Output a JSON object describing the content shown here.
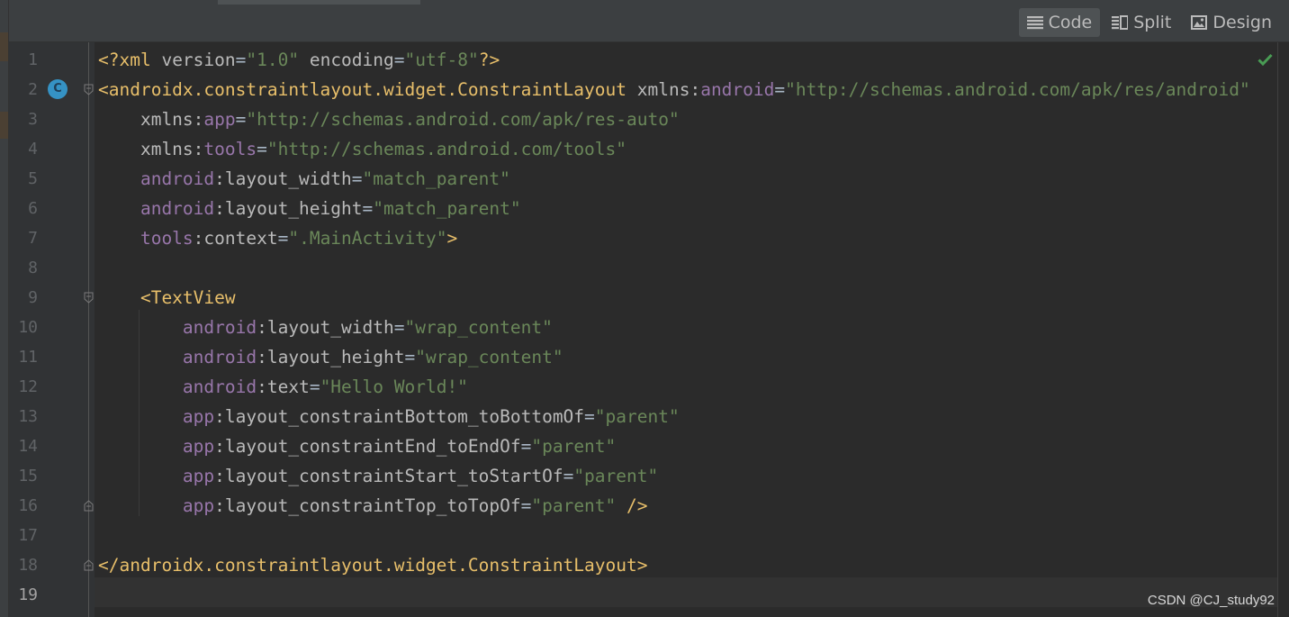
{
  "toolbar": {
    "code_label": "Code",
    "split_label": "Split",
    "design_label": "Design",
    "active_view": "Code"
  },
  "gutter": {
    "class_badge_letter": "C"
  },
  "lines": [
    {
      "num": "1",
      "segs": [
        [
          "tag",
          "<?xml "
        ],
        [
          "attr",
          "version"
        ],
        [
          "pun",
          "="
        ],
        [
          "str",
          "\"1.0\""
        ],
        [
          "attr",
          " encoding"
        ],
        [
          "pun",
          "="
        ],
        [
          "str",
          "\"utf-8\""
        ],
        [
          "tag",
          "?>"
        ]
      ]
    },
    {
      "num": "2",
      "segs": [
        [
          "tag",
          "<androidx.constraintlayout.widget.ConstraintLayout "
        ],
        [
          "attr",
          "xmlns:"
        ],
        [
          "ns",
          "android"
        ],
        [
          "pun",
          "="
        ],
        [
          "str",
          "\"http://schemas.android.com/apk/res/android\""
        ]
      ]
    },
    {
      "num": "3",
      "segs": [
        [
          "attr",
          "    xmlns:"
        ],
        [
          "ns",
          "app"
        ],
        [
          "pun",
          "="
        ],
        [
          "str",
          "\"http://schemas.android.com/apk/res-auto\""
        ]
      ]
    },
    {
      "num": "4",
      "segs": [
        [
          "attr",
          "    xmlns:"
        ],
        [
          "ns",
          "tools"
        ],
        [
          "pun",
          "="
        ],
        [
          "str",
          "\"http://schemas.android.com/tools\""
        ]
      ]
    },
    {
      "num": "5",
      "segs": [
        [
          "ns",
          "    android"
        ],
        [
          "attr",
          ":layout_width"
        ],
        [
          "pun",
          "="
        ],
        [
          "str",
          "\"match_parent\""
        ]
      ]
    },
    {
      "num": "6",
      "segs": [
        [
          "ns",
          "    android"
        ],
        [
          "attr",
          ":layout_height"
        ],
        [
          "pun",
          "="
        ],
        [
          "str",
          "\"match_parent\""
        ]
      ]
    },
    {
      "num": "7",
      "segs": [
        [
          "ns",
          "    tools"
        ],
        [
          "attr",
          ":context"
        ],
        [
          "pun",
          "="
        ],
        [
          "str",
          "\".MainActivity\""
        ],
        [
          "tag",
          ">"
        ]
      ]
    },
    {
      "num": "8",
      "segs": []
    },
    {
      "num": "9",
      "segs": [
        [
          "tag",
          "    <TextView"
        ]
      ]
    },
    {
      "num": "10",
      "segs": [
        [
          "ns",
          "        android"
        ],
        [
          "attr",
          ":layout_width"
        ],
        [
          "pun",
          "="
        ],
        [
          "str",
          "\"wrap_content\""
        ]
      ]
    },
    {
      "num": "11",
      "segs": [
        [
          "ns",
          "        android"
        ],
        [
          "attr",
          ":layout_height"
        ],
        [
          "pun",
          "="
        ],
        [
          "str",
          "\"wrap_content\""
        ]
      ]
    },
    {
      "num": "12",
      "segs": [
        [
          "ns",
          "        android"
        ],
        [
          "attr",
          ":text"
        ],
        [
          "pun",
          "="
        ],
        [
          "str",
          "\"Hello World!\""
        ]
      ]
    },
    {
      "num": "13",
      "segs": [
        [
          "ns",
          "        app"
        ],
        [
          "attr",
          ":layout_constraintBottom_toBottomOf"
        ],
        [
          "pun",
          "="
        ],
        [
          "str",
          "\"parent\""
        ]
      ]
    },
    {
      "num": "14",
      "segs": [
        [
          "ns",
          "        app"
        ],
        [
          "attr",
          ":layout_constraintEnd_toEndOf"
        ],
        [
          "pun",
          "="
        ],
        [
          "str",
          "\"parent\""
        ]
      ]
    },
    {
      "num": "15",
      "segs": [
        [
          "ns",
          "        app"
        ],
        [
          "attr",
          ":layout_constraintStart_toStartOf"
        ],
        [
          "pun",
          "="
        ],
        [
          "str",
          "\"parent\""
        ]
      ]
    },
    {
      "num": "16",
      "segs": [
        [
          "ns",
          "        app"
        ],
        [
          "attr",
          ":layout_constraintTop_toTopOf"
        ],
        [
          "pun",
          "="
        ],
        [
          "str",
          "\"parent\""
        ],
        [
          "tag",
          " />"
        ]
      ]
    },
    {
      "num": "17",
      "segs": []
    },
    {
      "num": "18",
      "segs": [
        [
          "tag",
          "</androidx.constraintlayout.widget.ConstraintLayout>"
        ]
      ]
    },
    {
      "num": "19",
      "segs": []
    }
  ],
  "fold_lines": [
    "2",
    "9",
    "16",
    "18"
  ],
  "current_line": "19",
  "watermark": "CSDN @CJ_study92",
  "colors": {
    "background": "#2b2b2b",
    "tag": "#e8bf6a",
    "namespace": "#9876aa",
    "attribute": "#bababa",
    "string": "#6a8759",
    "check": "#499c54",
    "class_badge": "#3592c4"
  }
}
